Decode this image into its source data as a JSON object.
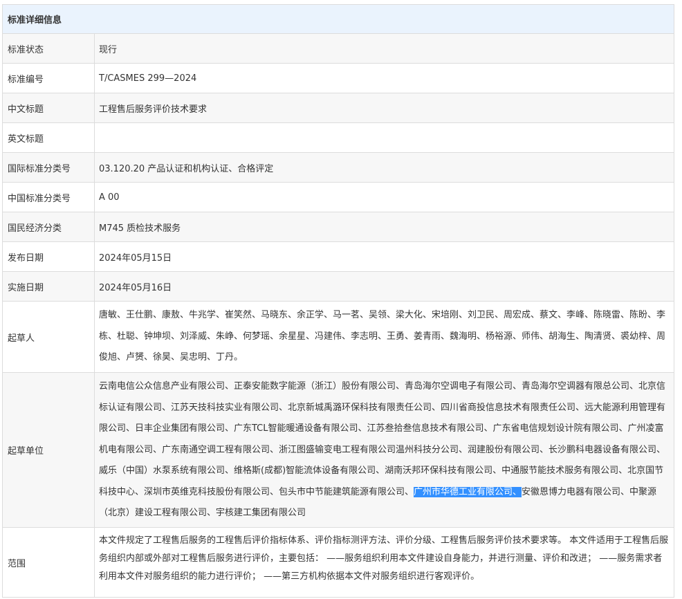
{
  "header": {
    "title": "标准详细信息"
  },
  "rows": {
    "status": {
      "label": "标准状态",
      "value": "现行"
    },
    "number": {
      "label": "标准编号",
      "value": "T/CASMES 299—2024"
    },
    "cn_title": {
      "label": "中文标题",
      "value": "工程售后服务评价技术要求"
    },
    "en_title": {
      "label": "英文标题",
      "value": ""
    },
    "ics": {
      "label": "国际标准分类号",
      "value": "03.120.20 产品认证和机构认证、合格评定"
    },
    "ccs": {
      "label": "中国标准分类号",
      "value": "A 00"
    },
    "econ": {
      "label": "国民经济分类",
      "value": "M745 质检技术服务"
    },
    "publish": {
      "label": "发布日期",
      "value": "2024年05月15日"
    },
    "effective": {
      "label": "实施日期",
      "value": "2024年05月16日"
    },
    "drafters": {
      "label": "起草人",
      "value": "唐敏、王仕鹏、康敖、牛兆学、崔笑然、马晓东、余正学、马一茗、吴领、梁大化、宋培刚、刘卫民、周宏成、蔡文、李峰、陈晓雷、陈盼、李栋、杜聪、钟坤坝、刘泽威、朱峥、何梦瑶、余星星、冯建伟、李志明、王勇、姜青雨、魏海明、杨裕源、师伟、胡海生、陶清贤、裘幼梓、周俊旭、卢赟、徐昊、吴忠明、丁丹。"
    },
    "units": {
      "label": "起草单位",
      "value_before": "云南电信公众信息产业有限公司、正泰安能数字能源（浙江）股份有限公司、青岛海尔空调电子有限公司、青岛海尔空调器有限总公司、北京信标认证有限公司、江苏天技科技实业有限公司、北京新城禹潞环保科技有限责任公司、四川省商投信息技术有限责任公司、远大能源利用管理有限公司、日丰企业集团有限公司、广东TCL智能暖通设备有限公司、江苏叁拾叁信息技术有限公司、广东省电信规划设计院有限公司、广州凌富机电有限公司、广东南通空调工程有限公司、浙江图盛输变电工程有限公司温州科技分公司、润建股份有限公司、长沙鹏科电器设备有限公司、威乐（中国）水泵系统有限公司、维格斯(成都)智能流体设备有限公司、湖南沃邦环保科技有限公司、中通服节能技术服务有限公司、北京国节科技中心、深圳市英维克科技股份有限公司、包头市中节能建筑能源有限公司、",
      "value_selected": "广州市华德工业有限公司、",
      "value_after": "安徽恩博力电器有限公司、中聚源（北京）建设工程有限公司、宇核建工集团有限公司"
    },
    "scope": {
      "label": "范围",
      "value": "本文件规定了工程售后服务的工程售后评价指标体系、评价指标测评方法、评价分级、工程售后服务评价技术要求等。 本文件适用于工程售后服务组织内部或外部对工程售后服务进行评价，主要包括： ——服务组织利用本文件建设自身能力，并进行测量、评价和改进； ——服务需求者利用本文件对服务组织的能力进行评价； ——第三方机构依据本文件对服务组织进行客观评价。"
    }
  },
  "colors": {
    "header_bg": "#eaf3fd",
    "alt_row_bg": "#f7f7f7",
    "border": "#dcdcdc",
    "selection": "#3390ff"
  }
}
